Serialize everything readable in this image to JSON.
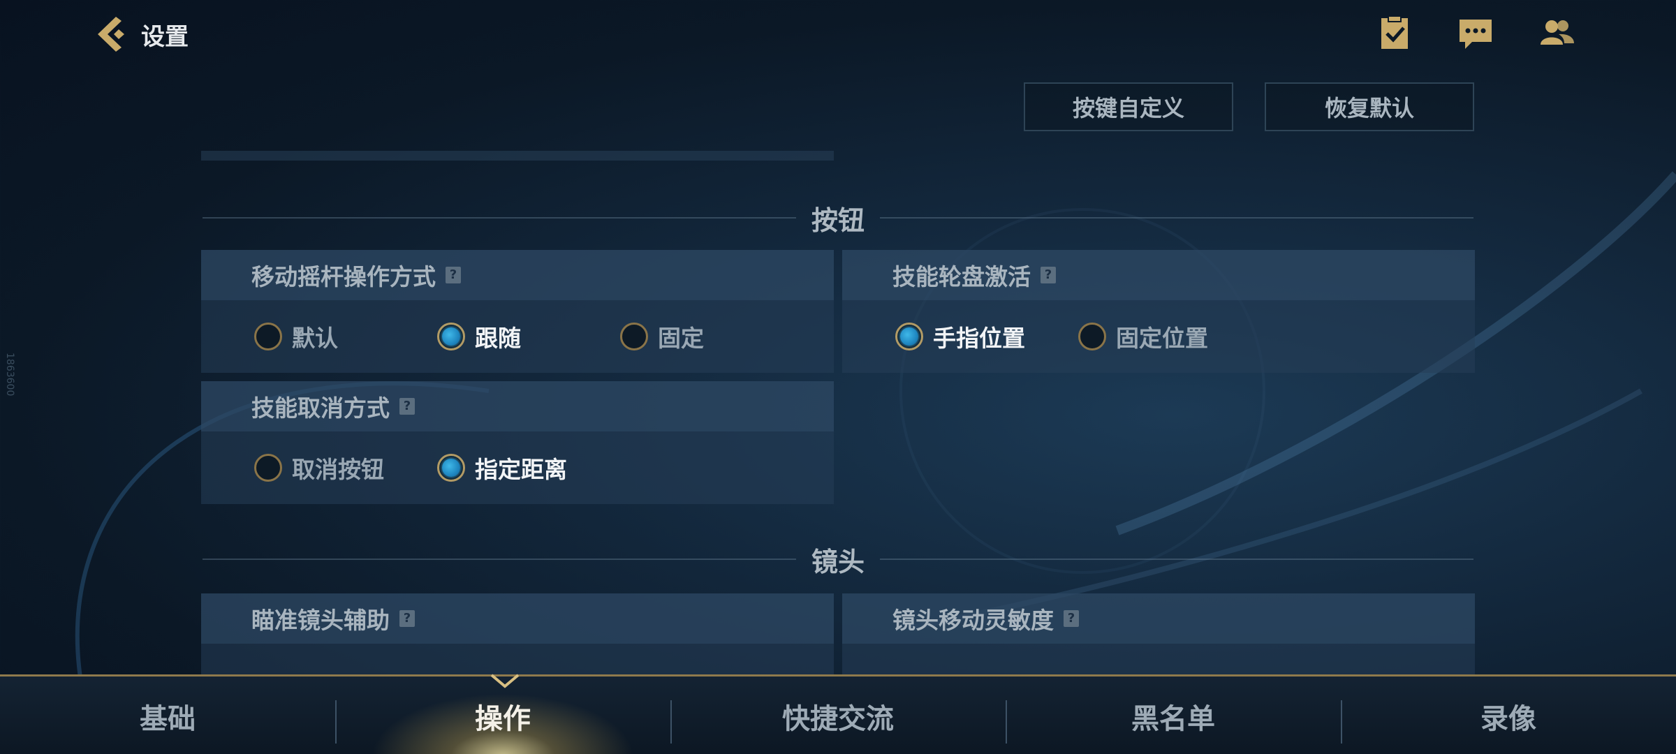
{
  "header": {
    "title": "设置",
    "buttons": {
      "customize": "按键自定义",
      "restore": "恢复默认"
    }
  },
  "side_text": "1863600",
  "sections": {
    "buttons_title": "按钮",
    "camera_title": "镜头"
  },
  "panels": {
    "joystick": {
      "title": "移动摇杆操作方式",
      "options": [
        {
          "label": "默认",
          "selected": false
        },
        {
          "label": "跟随",
          "selected": true
        },
        {
          "label": "固定",
          "selected": false
        }
      ]
    },
    "skill_wheel": {
      "title": "技能轮盘激活",
      "options": [
        {
          "label": "手指位置",
          "selected": true
        },
        {
          "label": "固定位置",
          "selected": false
        }
      ]
    },
    "skill_cancel": {
      "title": "技能取消方式",
      "options": [
        {
          "label": "取消按钮",
          "selected": false
        },
        {
          "label": "指定距离",
          "selected": true
        }
      ]
    },
    "aim_assist": {
      "title": "瞄准镜头辅助"
    },
    "camera_sensitivity": {
      "title": "镜头移动灵敏度"
    }
  },
  "bottom_nav": {
    "tabs": [
      "基础",
      "操作",
      "快捷交流",
      "黑名单",
      "录像"
    ],
    "active_index": 1
  },
  "colors": {
    "accent_gold": "#b59b63",
    "radio_on": "#1e86c0",
    "panel_bg": "#263e58"
  }
}
